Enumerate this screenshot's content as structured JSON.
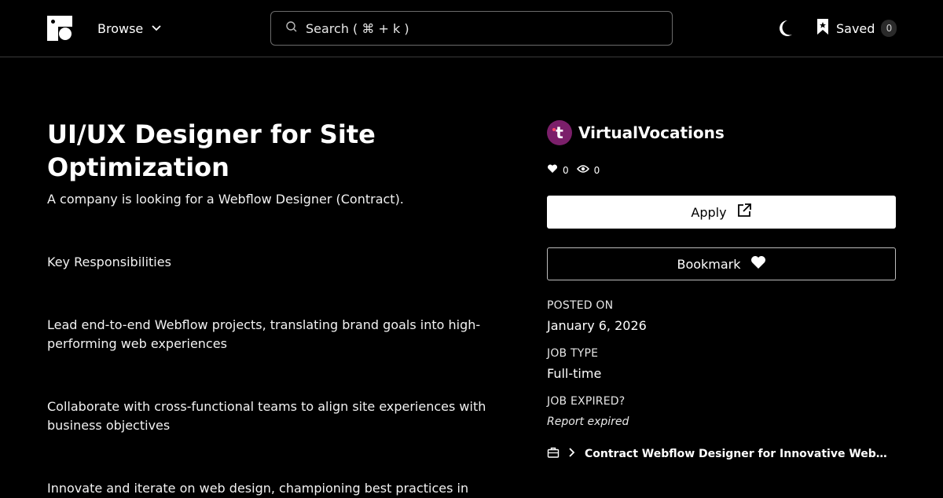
{
  "header": {
    "browse_label": "Browse",
    "search_placeholder": "Search ( ⌘ + k )",
    "saved_label": "Saved",
    "saved_count": "0"
  },
  "job": {
    "title": "UI/UX Designer for Site Optimization",
    "intro": "A company is looking for a Webflow Designer (Contract).",
    "section_heading": "Key Responsibilities",
    "responsibilities": [
      "Lead end-to-end Webflow projects, translating brand goals into high-performing web experiences",
      "Collaborate with cross-functional teams to align site experiences with business objectives",
      "Innovate and iterate on web design, championing best practices in"
    ]
  },
  "sidebar": {
    "company_name": "VirtualVocations",
    "company_logo_letter": "t",
    "likes": "0",
    "views": "0",
    "apply_label": "Apply",
    "bookmark_label": "Bookmark",
    "posted_on_label": "POSTED ON",
    "posted_on_value": "January 6, 2026",
    "job_type_label": "JOB TYPE",
    "job_type_value": "Full-time",
    "job_expired_label": "JOB EXPIRED?",
    "report_expired_label": "Report expired",
    "related_link": "Contract Webflow Designer for Innovative Web…"
  },
  "colors": {
    "background": "#000000",
    "text": "#ffffff",
    "company_logo_bg": "#7b1f6a",
    "apply_bg": "#ffffff"
  },
  "icons": [
    "logo-icon",
    "chevron-down-icon",
    "search-icon",
    "moon-icon",
    "bookmark-icon",
    "heart-icon",
    "eye-icon",
    "external-link-icon",
    "briefcase-icon",
    "chevron-right-icon"
  ]
}
